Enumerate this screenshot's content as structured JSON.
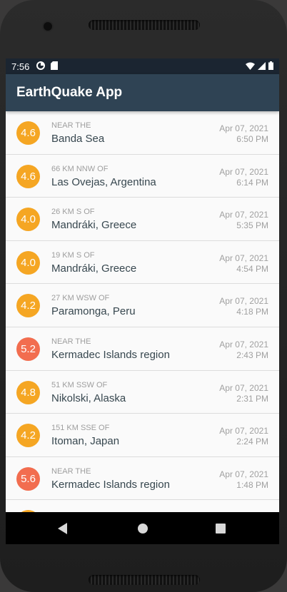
{
  "status_bar": {
    "time": "7:56",
    "icons": [
      "data-saver-icon",
      "sd-card-icon",
      "wifi-icon",
      "signal-icon",
      "battery-icon"
    ]
  },
  "app_bar": {
    "title": "EarthQuake App"
  },
  "colors": {
    "app_bar": "#2f4354",
    "status_bar": "#1b2531",
    "mag_orange": "#f5a623",
    "mag_red": "#f26d4f"
  },
  "earthquakes": [
    {
      "mag": "4.6",
      "offset": "NEAR THE",
      "place": "Banda Sea",
      "date": "Apr 07, 2021",
      "time": "6:50 PM",
      "color": "#f5a623"
    },
    {
      "mag": "4.6",
      "offset": "66 KM NNW OF",
      "place": "Las Ovejas, Argentina",
      "date": "Apr 07, 2021",
      "time": "6:14 PM",
      "color": "#f5a623"
    },
    {
      "mag": "4.0",
      "offset": "26 KM S OF",
      "place": "Mandráki, Greece",
      "date": "Apr 07, 2021",
      "time": "5:35 PM",
      "color": "#f5a623"
    },
    {
      "mag": "4.0",
      "offset": "19 KM S OF",
      "place": "Mandráki, Greece",
      "date": "Apr 07, 2021",
      "time": "4:54 PM",
      "color": "#f5a623"
    },
    {
      "mag": "4.2",
      "offset": "27 KM WSW OF",
      "place": "Paramonga, Peru",
      "date": "Apr 07, 2021",
      "time": "4:18 PM",
      "color": "#f5a623"
    },
    {
      "mag": "5.2",
      "offset": "NEAR THE",
      "place": "Kermadec Islands region",
      "date": "Apr 07, 2021",
      "time": "2:43 PM",
      "color": "#f26d4f"
    },
    {
      "mag": "4.8",
      "offset": "51 KM SSW OF",
      "place": "Nikolski, Alaska",
      "date": "Apr 07, 2021",
      "time": "2:31 PM",
      "color": "#f5a623"
    },
    {
      "mag": "4.2",
      "offset": "151 KM SSE OF",
      "place": "Itoman, Japan",
      "date": "Apr 07, 2021",
      "time": "2:24 PM",
      "color": "#f5a623"
    },
    {
      "mag": "5.6",
      "offset": "NEAR THE",
      "place": "Kermadec Islands region",
      "date": "Apr 07, 2021",
      "time": "1:48 PM",
      "color": "#f26d4f"
    },
    {
      "mag": "",
      "offset": "",
      "place": "",
      "date": "",
      "time": "",
      "color": "#f5a623"
    }
  ],
  "nav_bar": {
    "buttons": [
      "back-icon",
      "home-icon",
      "recents-icon"
    ]
  }
}
